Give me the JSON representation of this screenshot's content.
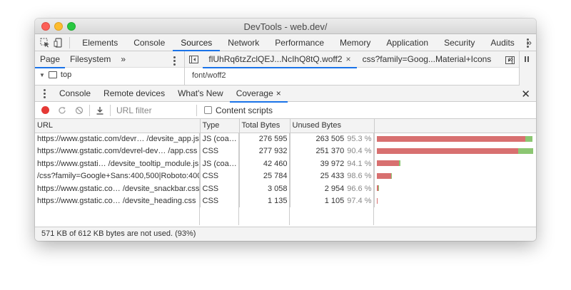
{
  "window": {
    "title": "DevTools - web.dev/"
  },
  "toolbar": {
    "tabs": [
      "Elements",
      "Console",
      "Sources",
      "Network",
      "Performance",
      "Memory",
      "Application",
      "Security",
      "Audits"
    ],
    "more": "»"
  },
  "sources": {
    "nav_tabs": [
      "Page",
      "Filesystem"
    ],
    "nav_more": "»",
    "tree_top": "top",
    "file_tabs": [
      "flUhRq6tzZclQEJ...NcIhQ8tQ.woff2",
      "css?family=Goog...Material+Icons"
    ],
    "close_glyph": "×",
    "file_more": "»",
    "mime": "font/woff2"
  },
  "drawer": {
    "tabs": [
      "Console",
      "Remote devices",
      "What's New",
      "Coverage"
    ],
    "close_glyph": "×",
    "close": "✕"
  },
  "coverage": {
    "url_filter_placeholder": "URL filter",
    "content_scripts_label": "Content scripts",
    "columns": [
      "URL",
      "Type",
      "Total Bytes",
      "Unused Bytes"
    ],
    "rows": [
      {
        "url": "https://www.gstatic.com/devr… /devsite_app.js",
        "type": "JS (coa…",
        "total": "276 595",
        "unused": "263 505",
        "pct": "95.3 %",
        "used_frac": 0.047
      },
      {
        "url": "https://www.gstatic.com/devrel-dev… /app.css",
        "type": "CSS",
        "total": "277 932",
        "unused": "251 370",
        "pct": "90.4 %",
        "used_frac": 0.096
      },
      {
        "url": "https://www.gstati… /devsite_tooltip_module.js",
        "type": "JS (coa…",
        "total": "42 460",
        "unused": "39 972",
        "pct": "94.1 %",
        "used_frac": 0.059
      },
      {
        "url": "/css?family=Google+Sans:400,500|Roboto:400,",
        "type": "CSS",
        "total": "25 784",
        "unused": "25 433",
        "pct": "98.6 %",
        "used_frac": 0.014
      },
      {
        "url": "https://www.gstatic.co… /devsite_snackbar.css",
        "type": "CSS",
        "total": "3 058",
        "unused": "2 954",
        "pct": "96.6 %",
        "used_frac": 0.034
      },
      {
        "url": "https://www.gstatic.co… /devsite_heading.css",
        "type": "CSS",
        "total": "1 135",
        "unused": "1 105",
        "pct": "97.4 %",
        "used_frac": 0.026
      }
    ],
    "status": "571 KB of 612 KB bytes are not used. (93%)",
    "colors": {
      "unused": "#d87070",
      "used": "#8cc672"
    }
  }
}
